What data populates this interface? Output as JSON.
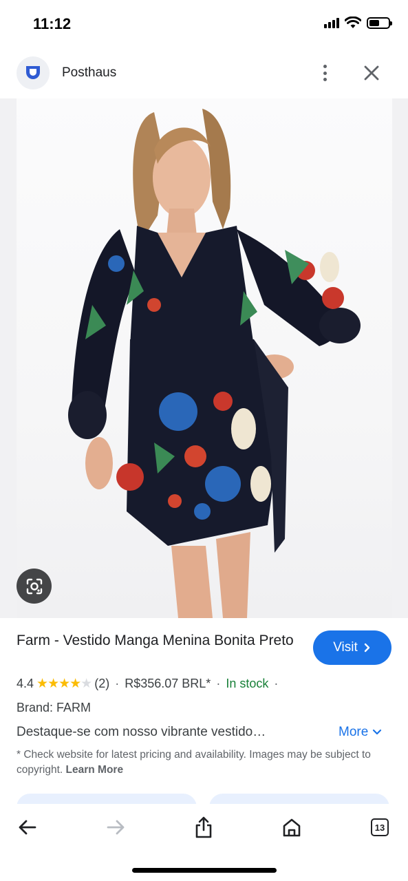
{
  "status_bar": {
    "time": "11:12"
  },
  "header": {
    "site_name": "Posthaus",
    "logo_icon": "posthaus-logo-icon",
    "menu_icon": "more-vert-icon",
    "close_icon": "close-icon"
  },
  "image": {
    "description_icon": "lens-icon"
  },
  "product": {
    "title": "Farm - Vestido Manga Menina Bonita Preto",
    "visit_label": "Visit",
    "rating": "4.4",
    "stars": "★★★★",
    "star_partial": "★",
    "review_count": "(2)",
    "price": "R$356.07 BRL*",
    "stock": "In stock",
    "brand": "Brand: FARM",
    "description": "Destaque-se com nosso vibrante vestido…",
    "more_label": "More",
    "disclaimer": "* Check website for latest pricing and availability. Images may be subject to copyright.",
    "learn_more": "Learn More"
  },
  "bottom_bar": {
    "tab_count": "13"
  },
  "colors": {
    "accent": "#1a73e8",
    "stock_green": "#188038",
    "star_yellow": "#fbbc04"
  }
}
